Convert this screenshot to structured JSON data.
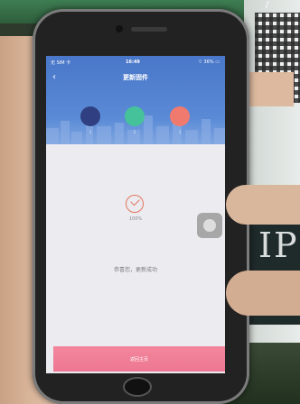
{
  "status_bar": {
    "carrier": "无 SIM 卡",
    "time": "16:49",
    "battery": "36%"
  },
  "nav": {
    "title": "更新固件"
  },
  "steps": [
    {
      "label": "1",
      "color": "#2f3f82"
    },
    {
      "label": "2",
      "color": "#46c29a"
    },
    {
      "label": "3",
      "color": "#f07a6e"
    }
  ],
  "progress": {
    "text": "100%",
    "value": 1.0
  },
  "message": "恭喜您，更新成功",
  "bottom_button_label": "返回主页",
  "icons": [
    "back-arrow-icon",
    "check-icon",
    "wifi-icon",
    "battery-icon",
    "assistive-touch-icon"
  ],
  "background_sign": {
    "text": "IP"
  },
  "colors": {
    "header_blue": "#4a77c9",
    "button_pink": "#ee7792",
    "check_orange": "#e2765f"
  }
}
